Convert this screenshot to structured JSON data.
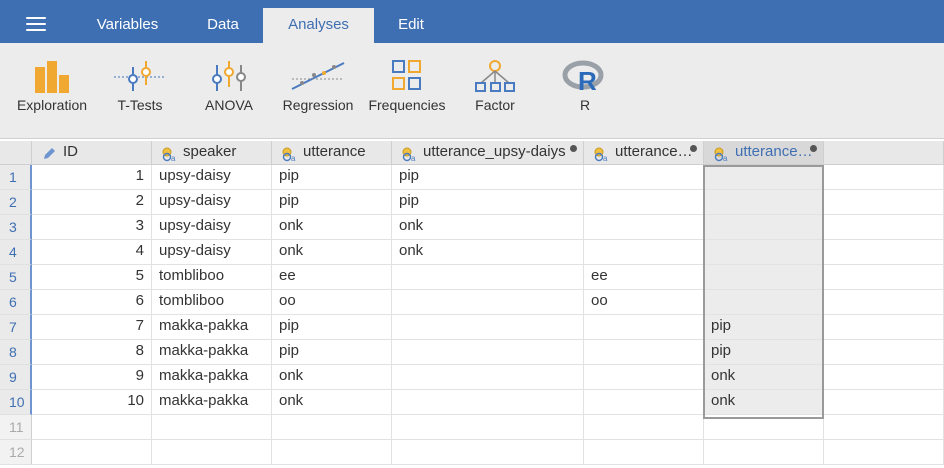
{
  "topbar": {
    "tabs": [
      {
        "label": "Variables",
        "active": false
      },
      {
        "label": "Data",
        "active": false
      },
      {
        "label": "Analyses",
        "active": true
      },
      {
        "label": "Edit",
        "active": false
      }
    ],
    "menu_icon": "hamburger-menu-icon",
    "colors": {
      "bar": "#3f6fb3",
      "active_tab_bg": "#ececec",
      "accent": "#3f6fb3"
    }
  },
  "ribbon": {
    "buttons": [
      {
        "label": "Exploration",
        "icon": "exploration-bar-chart-icon"
      },
      {
        "label": "T-Tests",
        "icon": "ttests-icon"
      },
      {
        "label": "ANOVA",
        "icon": "anova-icon"
      },
      {
        "label": "Regression",
        "icon": "regression-icon"
      },
      {
        "label": "Frequencies",
        "icon": "frequencies-icon"
      },
      {
        "label": "Factor",
        "icon": "factor-icon"
      },
      {
        "label": "R",
        "icon": "r-logo-icon"
      }
    ]
  },
  "grid": {
    "columns": [
      {
        "name": "ID",
        "icon": "pencil-icon",
        "dot": false,
        "selected": false
      },
      {
        "name": "speaker",
        "icon": "nominal-text-icon",
        "dot": false,
        "selected": false
      },
      {
        "name": "utterance",
        "icon": "nominal-text-icon",
        "dot": false,
        "selected": false
      },
      {
        "name": "utterance_upsy-daiys",
        "icon": "nominal-text-icon",
        "dot": true,
        "selected": false
      },
      {
        "name": "utterance…",
        "icon": "nominal-text-icon",
        "dot": true,
        "selected": false
      },
      {
        "name": "utterance…",
        "icon": "nominal-text-icon",
        "dot": true,
        "selected": true
      }
    ],
    "row_numbers": [
      "1",
      "2",
      "3",
      "4",
      "5",
      "6",
      "7",
      "8",
      "9",
      "10",
      "11",
      "12"
    ],
    "rows": [
      [
        "1",
        "upsy-daisy",
        "pip",
        "pip",
        "",
        ""
      ],
      [
        "2",
        "upsy-daisy",
        "pip",
        "pip",
        "",
        ""
      ],
      [
        "3",
        "upsy-daisy",
        "onk",
        "onk",
        "",
        ""
      ],
      [
        "4",
        "upsy-daisy",
        "onk",
        "onk",
        "",
        ""
      ],
      [
        "5",
        "tombliboo",
        "ee",
        "",
        "ee",
        ""
      ],
      [
        "6",
        "tombliboo",
        "oo",
        "",
        "oo",
        ""
      ],
      [
        "7",
        "makka-pakka",
        "pip",
        "",
        "",
        "pip"
      ],
      [
        "8",
        "makka-pakka",
        "pip",
        "",
        "",
        "pip"
      ],
      [
        "9",
        "makka-pakka",
        "onk",
        "",
        "",
        "onk"
      ],
      [
        "10",
        "makka-pakka",
        "onk",
        "",
        "",
        "onk"
      ]
    ]
  }
}
